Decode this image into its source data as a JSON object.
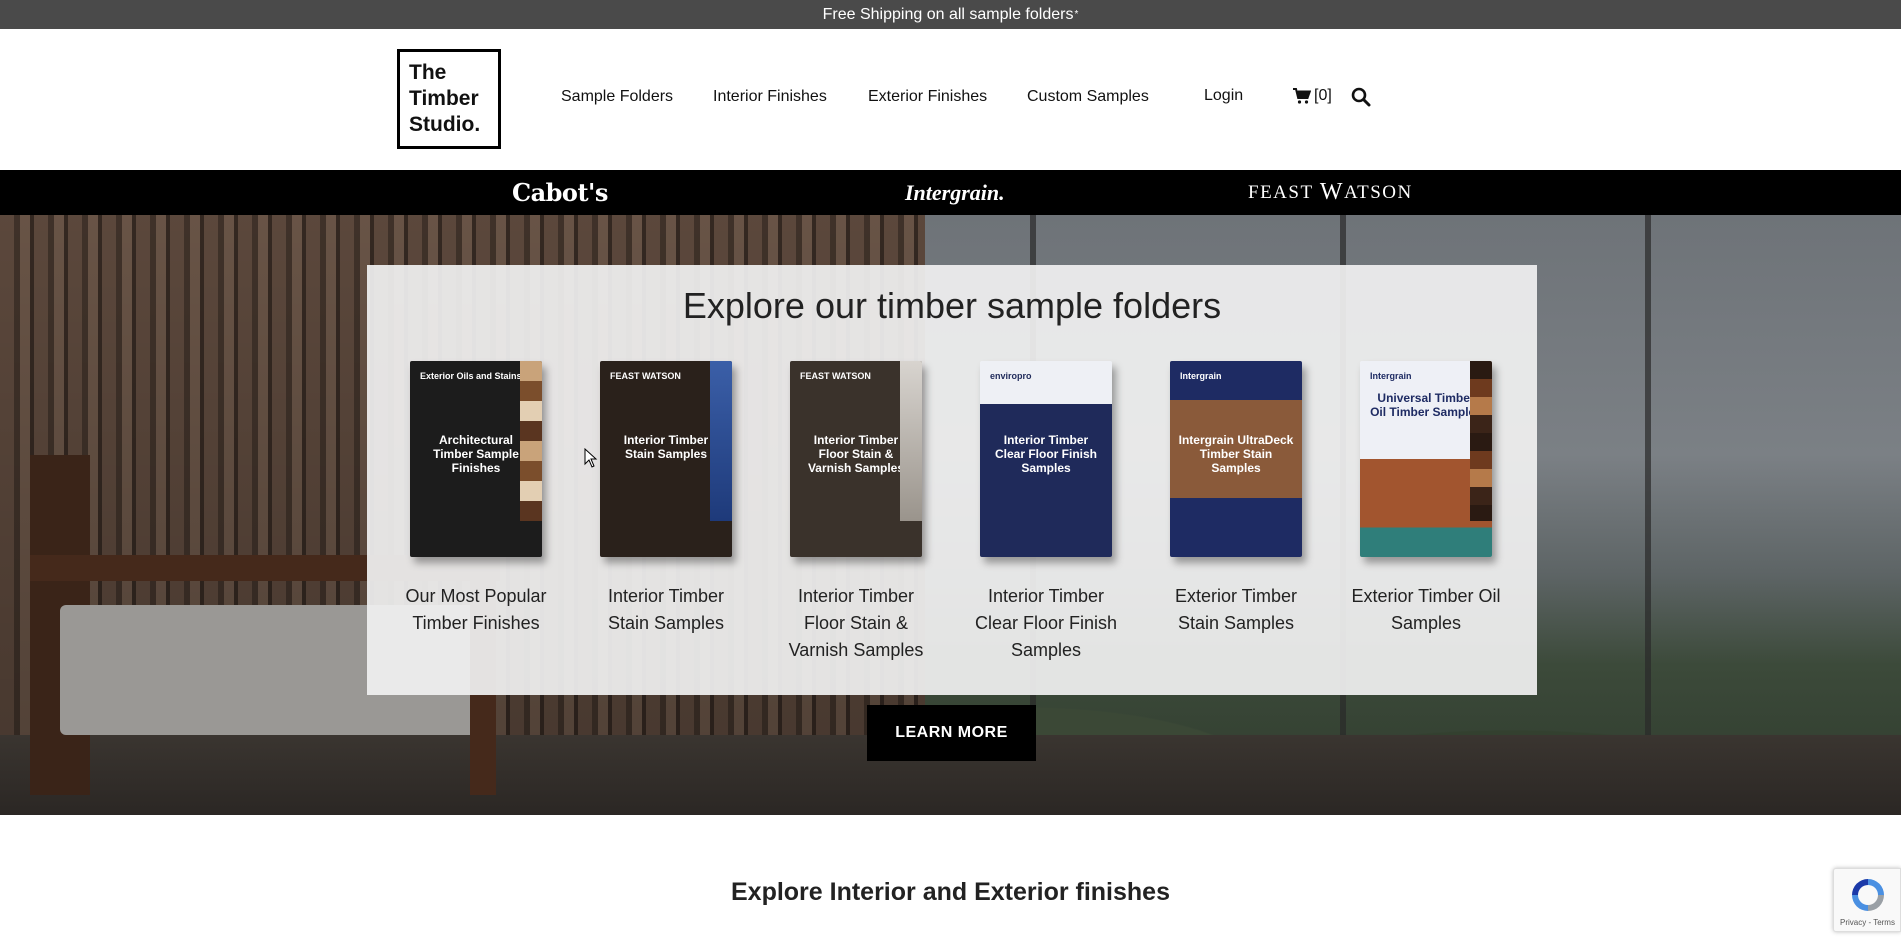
{
  "topbar": {
    "text": "Free Shipping on all sample folders",
    "sup": "*"
  },
  "logo": {
    "line1": "The",
    "line2": "Timber",
    "line3": "Studio."
  },
  "nav": [
    {
      "label": "Sample Folders"
    },
    {
      "label": "Interior Finishes"
    },
    {
      "label": "Exterior Finishes"
    },
    {
      "label": "Custom Samples"
    },
    {
      "label": "Login"
    }
  ],
  "cart": {
    "count": "[0]",
    "icon": "cart-icon"
  },
  "search": {
    "icon": "search-icon"
  },
  "brands": {
    "cabots": "Cabot's",
    "intergrain": "Intergrain.",
    "feast_watson": {
      "part1": "FEAST",
      "part2": "W",
      "part3": "ATSON"
    }
  },
  "hero": {
    "title": "Explore our timber sample folders",
    "folders": [
      {
        "label_line1": "Our Most Popular",
        "label_line2": "Timber Finishes",
        "label_line3": "",
        "cover_tag": "Exterior Oils and Stains",
        "cover_title": "Architectural Timber Sample Finishes",
        "cover_bg": "#1c1c1c",
        "cover_fg": "#ffffff"
      },
      {
        "label_line1": "Interior Timber",
        "label_line2": "Stain Samples",
        "label_line3": "",
        "cover_tag": "FEAST WATSON",
        "cover_title": "Interior Timber Stain Samples",
        "cover_bg": "#2a211b",
        "cover_fg": "#ffffff"
      },
      {
        "label_line1": "Interior Timber",
        "label_line2": "Floor Stain &",
        "label_line3": "Varnish Samples",
        "cover_tag": "FEAST WATSON",
        "cover_title": "Interior Timber Floor Stain & Varnish Samples",
        "cover_bg": "#3a322b",
        "cover_fg": "#ffffff"
      },
      {
        "label_line1": "Interior Timber",
        "label_line2": "Clear Floor Finish",
        "label_line3": "Samples",
        "cover_tag": "enviropro",
        "cover_title": "Interior Timber Clear Floor Finish Samples",
        "cover_bg": "#1f2a5a",
        "cover_fg": "#ffffff"
      },
      {
        "label_line1": "Exterior Timber",
        "label_line2": "Stain Samples",
        "label_line3": "",
        "cover_tag": "Intergrain",
        "cover_title": "Intergrain UltraDeck Timber Stain Samples",
        "cover_bg": "#1e2b63",
        "cover_fg": "#ffffff"
      },
      {
        "label_line1": "Exterior Timber Oil",
        "label_line2": "Samples",
        "label_line3": "",
        "cover_tag": "Intergrain",
        "cover_title": "Universal Timber Oil Timber Samples",
        "cover_bg": "#e9ecf2",
        "cover_fg": "#1e2b63"
      }
    ],
    "button": "LEARN MORE"
  },
  "section2": {
    "title": "Explore Interior and Exterior finishes"
  },
  "recaptcha": {
    "text": "Privacy - Terms"
  },
  "colors": {
    "topbar": "#4a4a4a",
    "brandbar": "#000000",
    "button": "#000000"
  }
}
